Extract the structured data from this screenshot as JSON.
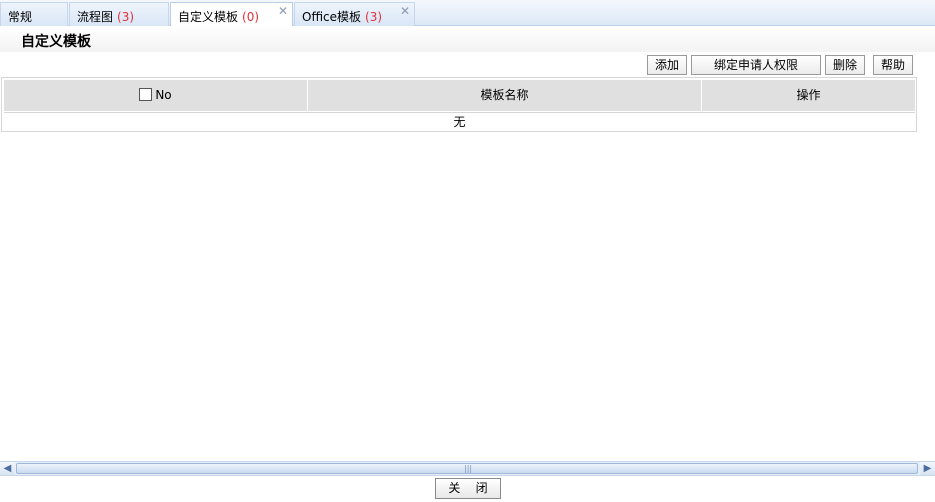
{
  "tabs": [
    {
      "label": "常规",
      "count": "",
      "active": false,
      "closable": false
    },
    {
      "label": "流程图",
      "count": "(3)",
      "active": false,
      "closable": false
    },
    {
      "label": "自定义模板",
      "count": "(0)",
      "active": true,
      "closable": true
    },
    {
      "label": "Office模板",
      "count": "(3)",
      "active": false,
      "closable": true
    }
  ],
  "header": {
    "title": "自定义模板"
  },
  "toolbar": {
    "add_label": "添加",
    "bind_label": "绑定申请人权限",
    "delete_label": "删除",
    "help_label": "帮助"
  },
  "table": {
    "columns": [
      "No",
      "模板名称",
      "操作"
    ],
    "empty_text": "无"
  },
  "footer": {
    "close_label": "关 闭"
  },
  "icons": {
    "tab_close": "close-icon",
    "scroll_left": "arrow-left-icon",
    "scroll_right": "arrow-right-icon"
  },
  "colors": {
    "tab_count": "#e0313a",
    "tab_border": "#c7d6ea",
    "header_bg": "#e0e0e0"
  }
}
